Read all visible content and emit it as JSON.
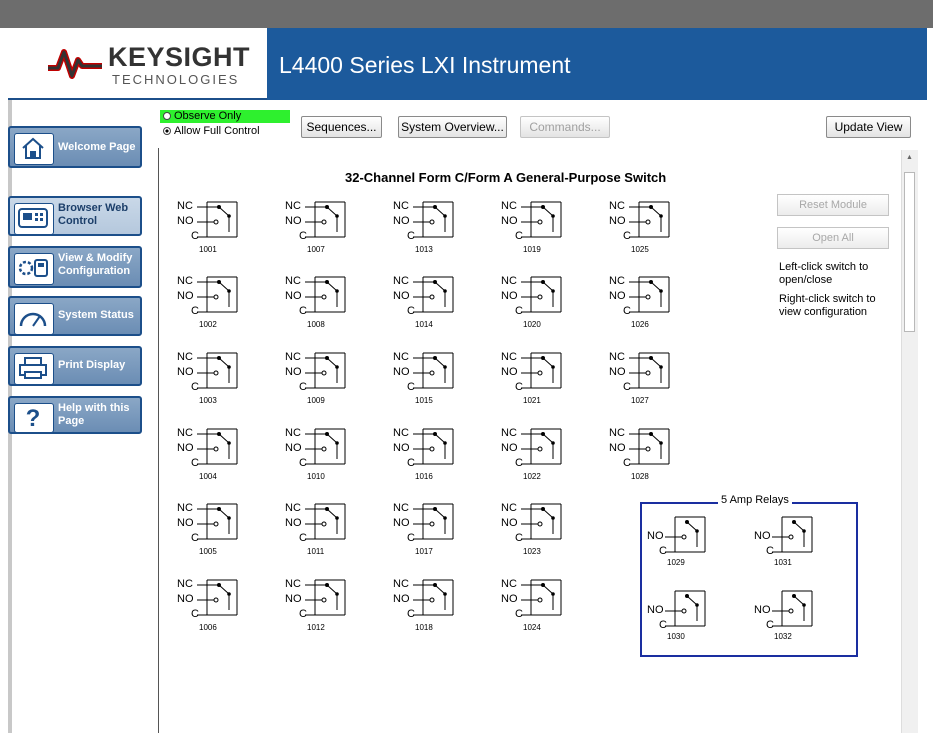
{
  "header": {
    "brand_name": "KEYSIGHT",
    "brand_sub": "TECHNOLOGIES",
    "title": "L4400 Series LXI Instrument",
    "brand_color": "#1c5a9c"
  },
  "nav": [
    {
      "label": "Welcome Page",
      "icon": "home-icon"
    },
    {
      "label": "Browser Web Control",
      "icon": "web-control-icon"
    },
    {
      "label": "View & Modify Configuration",
      "icon": "configuration-icon"
    },
    {
      "label": "System Status",
      "icon": "gauge-icon"
    },
    {
      "label": "Print Display",
      "icon": "printer-icon"
    },
    {
      "label": "Help with this Page",
      "icon": "help-icon"
    }
  ],
  "controls": {
    "observe_label": "Observe Only",
    "allow_label": "Allow Full Control",
    "selected_mode": "Allow Full Control",
    "sequences": "Sequences...",
    "system_overview": "System Overview...",
    "commands": "Commands...",
    "update_view": "Update View"
  },
  "panel": {
    "title": "32-Channel Form C/Form A General-Purpose Switch",
    "reset_module": "Reset Module",
    "open_all": "Open All",
    "note1": "Left-click switch to open/close",
    "note2": "Right-click switch to view configuration",
    "relay_title": "5 Amp Relays"
  },
  "terminals": {
    "nc": "NC",
    "no": "NO",
    "c": "C"
  },
  "formc_channels": [
    [
      "1001",
      "1002",
      "1003",
      "1004",
      "1005",
      "1006"
    ],
    [
      "1007",
      "1008",
      "1009",
      "1010",
      "1011",
      "1012"
    ],
    [
      "1013",
      "1014",
      "1015",
      "1016",
      "1017",
      "1018"
    ],
    [
      "1019",
      "1020",
      "1021",
      "1022",
      "1023",
      "1024"
    ],
    [
      "1025",
      "1026",
      "1027",
      "1028"
    ]
  ],
  "forma_channels": [
    [
      "1029",
      "1030"
    ],
    [
      "1031",
      "1032"
    ]
  ]
}
